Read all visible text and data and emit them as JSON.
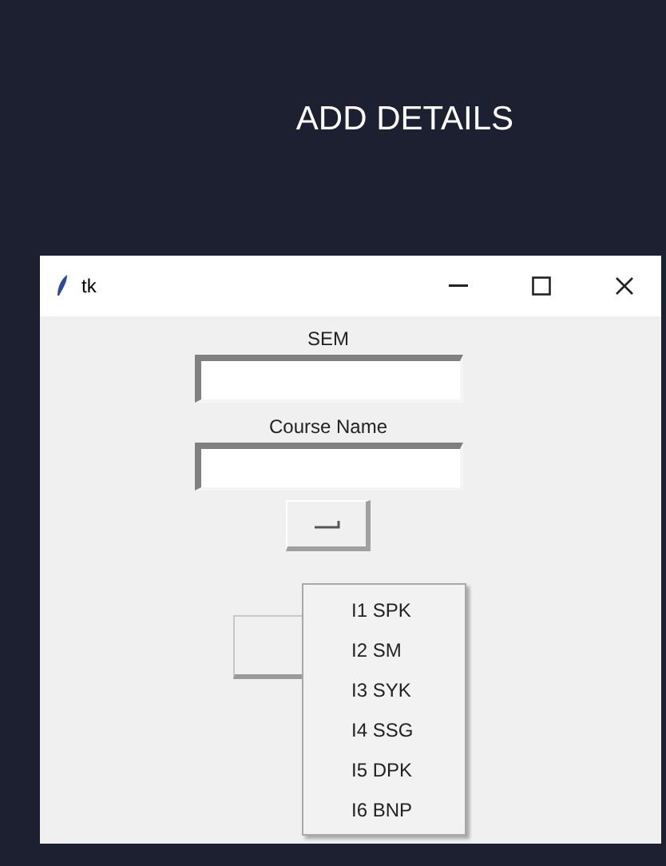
{
  "heading": "ADD DETAILS",
  "window": {
    "title": "tk"
  },
  "fields": [
    {
      "label": "SEM"
    },
    {
      "label": "Course Name"
    }
  ],
  "menu": {
    "items": [
      {
        "label": "I1 SPK"
      },
      {
        "label": "I2 SM"
      },
      {
        "label": "I3 SYK"
      },
      {
        "label": "I4 SSG"
      },
      {
        "label": "I5 DPK"
      },
      {
        "label": "I6 BNP"
      }
    ]
  }
}
